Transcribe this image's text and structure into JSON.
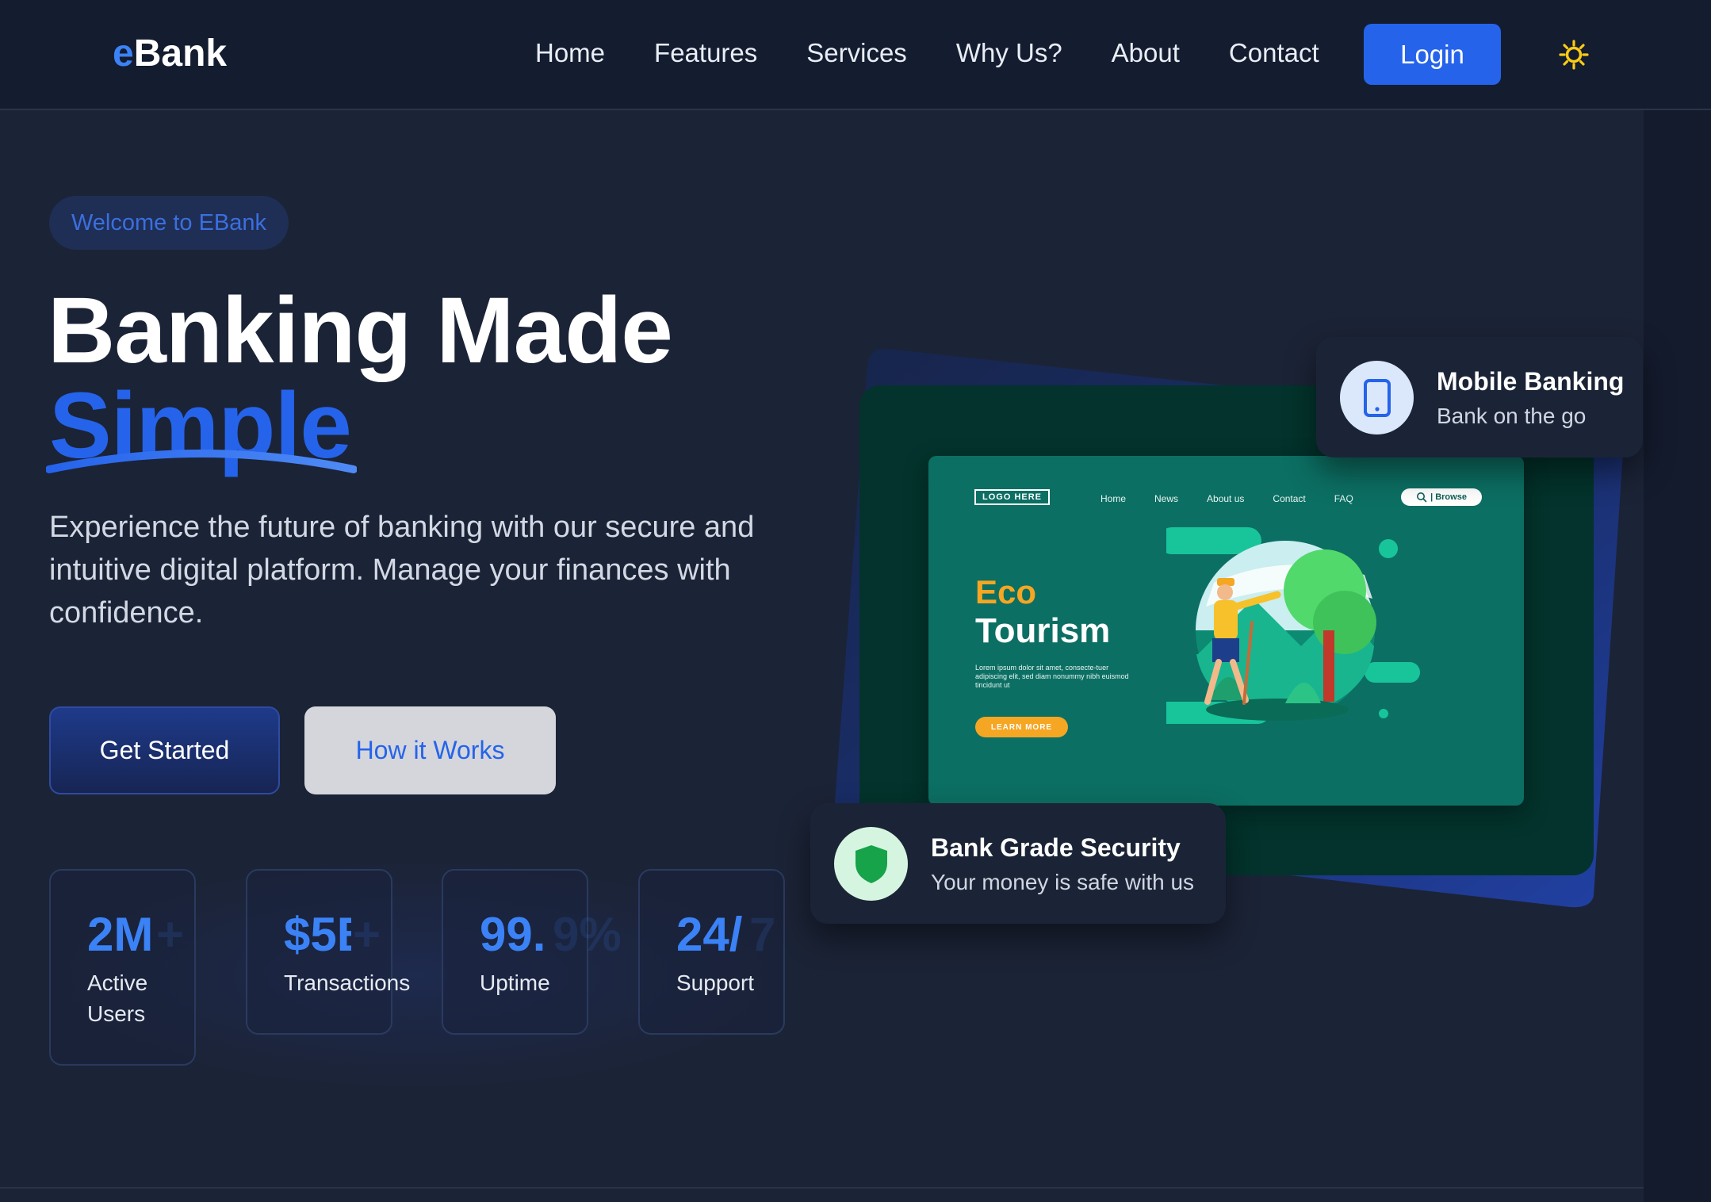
{
  "brand": {
    "prefix": "e",
    "name": "Bank"
  },
  "nav": {
    "links": [
      "Home",
      "Features",
      "Services",
      "Why Us?",
      "About",
      "Contact"
    ],
    "login_label": "Login",
    "theme_icon": "sun-icon"
  },
  "hero": {
    "badge": "Welcome to EBank",
    "title_line1": "Banking Made",
    "title_accent": "Simple",
    "description": "Experience the future of banking with our secure and intuitive digital platform. Manage your finances with confidence.",
    "primary_button": "Get Started",
    "secondary_button": "How it Works"
  },
  "stats": [
    {
      "value": "2M",
      "ghost": "+",
      "label_line1": "Active",
      "label_line2": "Users"
    },
    {
      "value": "$5B",
      "ghost": "+",
      "label_line1": "Transactions",
      "label_line2": ""
    },
    {
      "value": "99.",
      "ghost": "9%",
      "label_line1": "Uptime",
      "label_line2": ""
    },
    {
      "value": "24/",
      "ghost": "7",
      "label_line1": "Support",
      "label_line2": ""
    }
  ],
  "mockup": {
    "logo": "LOGO HERE",
    "nav": [
      "Home",
      "News",
      "About us",
      "Contact",
      "FAQ"
    ],
    "browse": "| Browse",
    "heading_accent": "Eco",
    "heading": "Tourism",
    "lorem": "Lorem ipsum dolor sit amet, consecte-tuer adipiscing elit, sed diam nonummy nibh euismod tincidunt ut",
    "cta": "LEARN MORE"
  },
  "cards": {
    "mobile": {
      "title": "Mobile Banking",
      "subtitle": "Bank on the go",
      "icon": "phone-icon"
    },
    "security": {
      "title": "Bank Grade Security",
      "subtitle": "Your money is safe with us",
      "icon": "shield-icon"
    }
  },
  "colors": {
    "accent": "#2563eb",
    "background": "#1b2336",
    "nav_bg": "#141c2f",
    "teal": "#03332c",
    "sun": "#facc15"
  }
}
